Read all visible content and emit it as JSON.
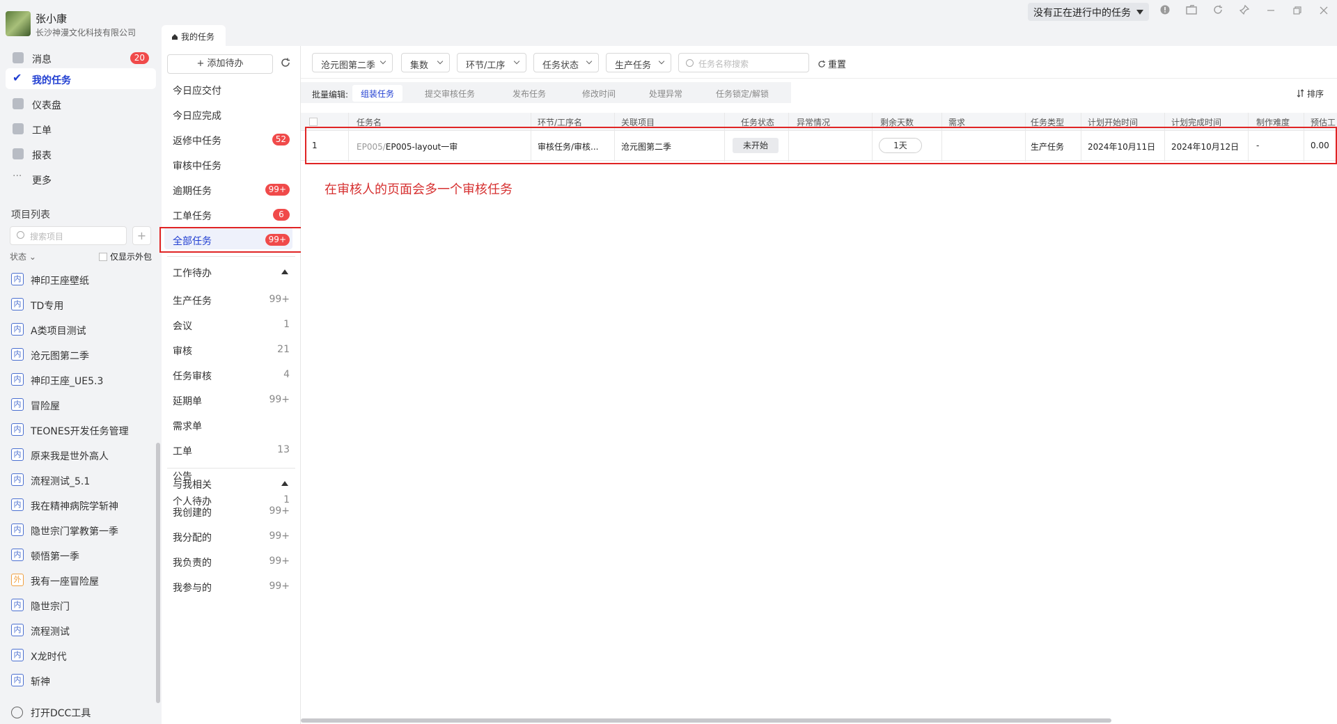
{
  "user": {
    "name": "张小康",
    "company": "长沙神漫文化科技有限公司"
  },
  "tabs": {
    "active_label": "我的任务"
  },
  "window": {
    "current_task": "没有正在进行中的任务"
  },
  "nav": [
    {
      "label": "消息",
      "badge": "20"
    },
    {
      "label": "我的任务"
    },
    {
      "label": "仪表盘"
    },
    {
      "label": "工单"
    },
    {
      "label": "报表"
    },
    {
      "label": "更多"
    }
  ],
  "projects": {
    "title": "项目列表",
    "search_placeholder": "搜索项目",
    "status_label": "状态",
    "only_external_label": "仅显示外包",
    "items": [
      {
        "tag": "内",
        "name": "神印王座壁纸"
      },
      {
        "tag": "内",
        "name": "TD专用"
      },
      {
        "tag": "内",
        "name": "A类项目测试"
      },
      {
        "tag": "内",
        "name": "沧元图第二季"
      },
      {
        "tag": "内",
        "name": "神印王座_UE5.3"
      },
      {
        "tag": "内",
        "name": "冒险屋"
      },
      {
        "tag": "内",
        "name": "TEONES开发任务管理"
      },
      {
        "tag": "内",
        "name": "原来我是世外高人"
      },
      {
        "tag": "内",
        "name": "流程测试_5.1"
      },
      {
        "tag": "内",
        "name": "我在精神病院学斩神"
      },
      {
        "tag": "内",
        "name": "隐世宗门掌教第一季"
      },
      {
        "tag": "内",
        "name": "顿悟第一季"
      },
      {
        "tag": "外",
        "name": "我有一座冒险屋"
      },
      {
        "tag": "内",
        "name": "隐世宗门"
      },
      {
        "tag": "内",
        "name": "流程测试"
      },
      {
        "tag": "内",
        "name": "X龙时代"
      },
      {
        "tag": "内",
        "name": "斩神"
      }
    ],
    "dcc_label": "打开DCC工具"
  },
  "todo": {
    "add_label": "+ 添加待办",
    "quick": [
      {
        "label": "今日应交付"
      },
      {
        "label": "今日应完成"
      },
      {
        "label": "返修中任务",
        "badge": "52"
      },
      {
        "label": "审核中任务"
      },
      {
        "label": "逾期任务",
        "badge": "99+"
      },
      {
        "label": "工单任务",
        "badge": "6"
      },
      {
        "label": "全部任务",
        "badge": "99+"
      }
    ],
    "work_section": "工作待办",
    "work": [
      {
        "label": "生产任务",
        "count": "99+"
      },
      {
        "label": "会议",
        "count": "1"
      },
      {
        "label": "审核",
        "count": "21"
      },
      {
        "label": "任务审核",
        "count": "4"
      },
      {
        "label": "延期单",
        "count": "99+"
      },
      {
        "label": "需求单",
        "count": ""
      },
      {
        "label": "工单",
        "count": "13"
      },
      {
        "label": "公告",
        "count": ""
      },
      {
        "label": "个人待办",
        "count": "1"
      }
    ],
    "related_section": "与我相关",
    "related": [
      {
        "label": "我创建的",
        "count": "99+"
      },
      {
        "label": "我分配的",
        "count": "99+"
      },
      {
        "label": "我负责的",
        "count": "99+"
      },
      {
        "label": "我参与的",
        "count": "99+"
      }
    ]
  },
  "filters": {
    "project": "沧元图第二季",
    "episode": "集数",
    "step": "环节/工序",
    "status": "任务状态",
    "type": "生产任务",
    "search_placeholder": "任务名称搜索",
    "reset": "重置"
  },
  "batch": {
    "label": "批量编辑:",
    "buttons": [
      "组装任务",
      "提交审核任务",
      "发布任务",
      "修改时间",
      "处理异常",
      "任务锁定/解锁"
    ],
    "sort": "排序"
  },
  "table": {
    "headers": [
      "任务名",
      "环节/工序名",
      "关联项目",
      "任务状态",
      "异常情况",
      "剩余天数",
      "需求",
      "任务类型",
      "计划开始时间",
      "计划完成时间",
      "制作难度",
      "预估工"
    ],
    "rows": [
      {
        "index": "1",
        "name_prefix": "EP005/",
        "name": "EP005-layout一审",
        "step": "审核任务/审核...",
        "project": "沧元图第二季",
        "status": "未开始",
        "abnormal": "",
        "days_left": "1天",
        "demand": "",
        "type": "生产任务",
        "plan_start": "2024年10月11日",
        "plan_end": "2024年10月12日",
        "difficulty": "-",
        "estimate": "0.00"
      }
    ]
  },
  "annotation": "在审核人的页面会多一个审核任务",
  "colors": {
    "accent": "#1f3dd1",
    "badge": "#f04a4a",
    "highlight_box": "#e02424"
  }
}
